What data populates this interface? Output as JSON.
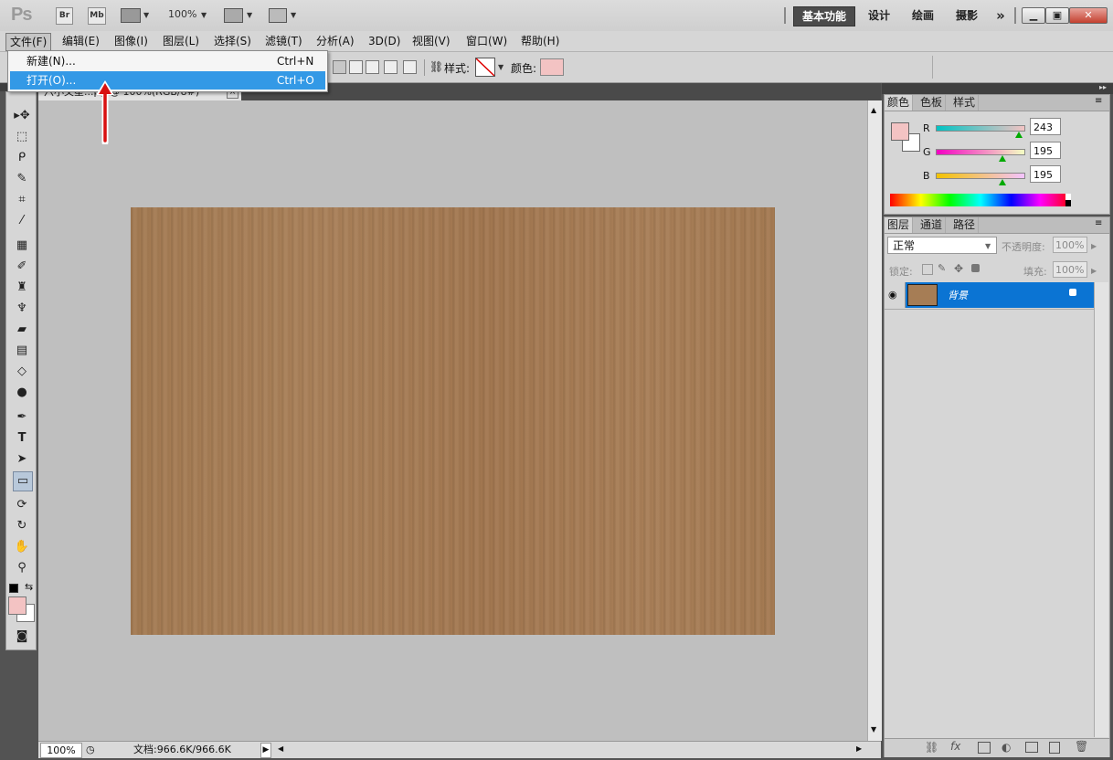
{
  "appbar": {
    "logo": "Ps",
    "bridge": "Br",
    "minibridge": "Mb",
    "zoom": "100%",
    "workspaces": [
      "基本功能",
      "设计",
      "绘画",
      "摄影"
    ],
    "more": "»"
  },
  "menubar": {
    "items": [
      "文件(F)",
      "编辑(E)",
      "图像(I)",
      "图层(L)",
      "选择(S)",
      "滤镜(T)",
      "分析(A)",
      "3D(D)",
      "视图(V)",
      "窗口(W)",
      "帮助(H)"
    ]
  },
  "file_menu": {
    "items": [
      {
        "label": "新建(N)...",
        "shortcut": "Ctrl+N"
      },
      {
        "label": "打开(O)...",
        "shortcut": "Ctrl+O"
      }
    ]
  },
  "options": {
    "style_label": "样式:",
    "color_label": "颜色:",
    "swatch_color": "#f3c3c3"
  },
  "document": {
    "tab_title": "六小文星...pg @ 100%(RGB/8#)",
    "zoom": "100%",
    "doc_info": "文档:966.6K/966.6K"
  },
  "color_panel": {
    "tabs": [
      "颜色",
      "色板",
      "样式"
    ],
    "r_label": "R",
    "g_label": "G",
    "b_label": "B",
    "r": "243",
    "g": "195",
    "b": "195",
    "r_fraction": 0.953,
    "g_fraction": 0.765,
    "b_fraction": 0.765,
    "foreground": "#f3c3c3"
  },
  "layers_panel": {
    "tabs": [
      "图层",
      "通道",
      "路径"
    ],
    "blend_mode": "正常",
    "opacity_label": "不透明度:",
    "opacity": "100%",
    "lock_label": "锁定:",
    "fill_label": "填充:",
    "fill": "100%",
    "layer_name": "背景"
  }
}
